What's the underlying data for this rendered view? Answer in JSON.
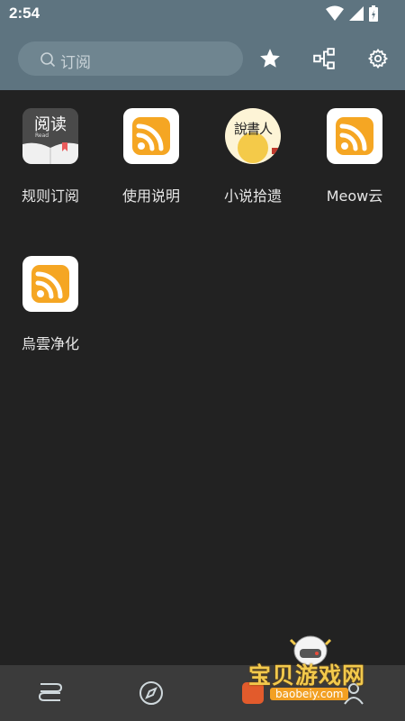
{
  "status": {
    "time": "2:54"
  },
  "search": {
    "placeholder": "订阅"
  },
  "toolbar": {
    "icons": [
      "star-icon",
      "rule-tree-icon",
      "gear-icon"
    ]
  },
  "subscriptions": [
    {
      "label": "规则订阅",
      "icon": "read-book-icon",
      "icon_text": "阅读",
      "icon_sub": "Read"
    },
    {
      "label": "使用说明",
      "icon": "rss-icon"
    },
    {
      "label": "小说拾遗",
      "icon": "storyteller-logo",
      "icon_text": "說書人"
    },
    {
      "label": "Meow云",
      "icon": "rss-icon"
    },
    {
      "label": "烏雲净化",
      "icon": "rss-icon"
    }
  ],
  "bottom_nav": {
    "icons": [
      "bookshelf-icon",
      "compass-icon",
      "rss-nav-icon",
      "person-icon"
    ]
  },
  "watermark": {
    "text": "宝贝游戏网",
    "url": "baobeiy.com"
  },
  "colors": {
    "header": "#5e7480",
    "background": "#222222",
    "rss": "#f5a623"
  }
}
